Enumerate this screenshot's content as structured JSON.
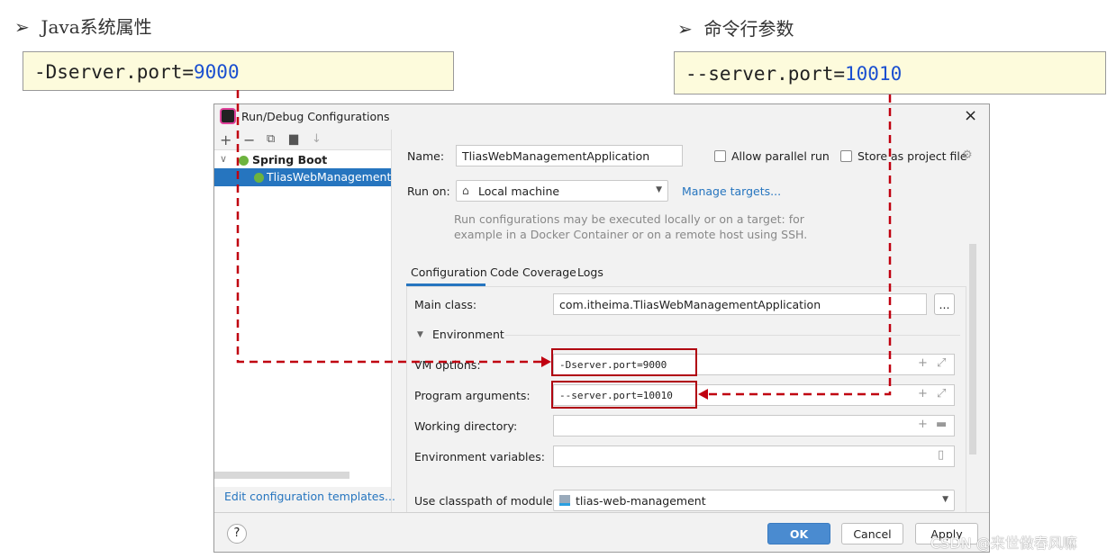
{
  "left_note": {
    "bullet": "➢",
    "title": "Java系统属性",
    "code_prefix": "-Dserver.port=",
    "code_value": "9000"
  },
  "right_note": {
    "bullet": "➢",
    "title": "命令行参数",
    "code_prefix": "--server.port=",
    "code_value": "10010"
  },
  "dialog": {
    "title": "Run/Debug Configurations",
    "tree": {
      "group": "Spring Boot",
      "item": "TliasWebManagementA"
    },
    "edit_templates": "Edit configuration templates...",
    "name_label": "Name:",
    "name_value": "TliasWebManagementApplication",
    "allow_parallel": "Allow parallel run",
    "store_project": "Store as project file",
    "run_on_label": "Run on:",
    "run_on_value": "Local machine",
    "manage_targets": "Manage targets...",
    "hint_line1": "Run configurations may be executed locally or on a target: for",
    "hint_line2": "example in a Docker Container or on a remote host using SSH.",
    "tabs": [
      "Configuration",
      "Code Coverage",
      "Logs"
    ],
    "main_class_label": "Main class:",
    "main_class_value": "com.itheima.TliasWebManagementApplication",
    "environment": "Environment",
    "vm_label": "VM options:",
    "vm_value": "-Dserver.port=9000",
    "args_label": "Program arguments:",
    "args_value": "--server.port=10010",
    "workdir_label": "Working directory:",
    "envvars_label": "Environment variables:",
    "classpath_label": "Use classpath of module:",
    "classpath_value": "tlias-web-management",
    "ok": "OK",
    "cancel": "Cancel",
    "apply": "Apply",
    "help": "?"
  },
  "watermark": "CSDN @来世做春风嘛",
  "colors": {
    "accent": "#2675bf",
    "highlight": "#b00010",
    "ok_button": "#4a8bd0"
  }
}
